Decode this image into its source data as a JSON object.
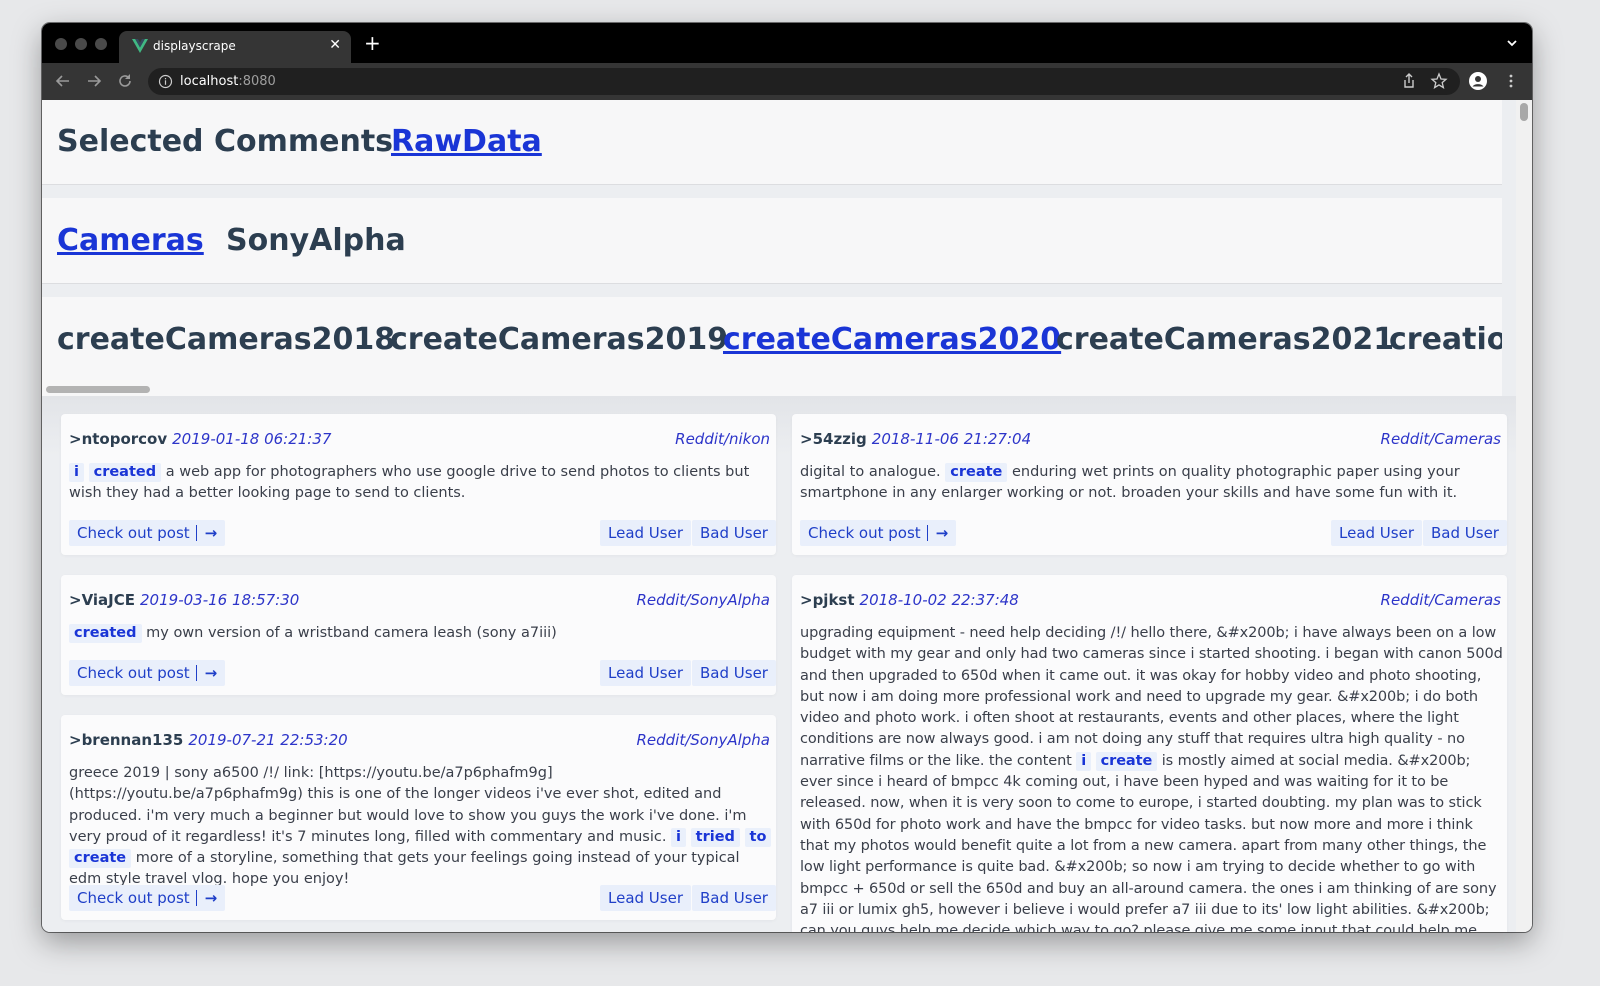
{
  "browser": {
    "tab_title": "displayscrape",
    "url_host": "localhost",
    "url_port": ":8080"
  },
  "nav": {
    "top": [
      {
        "label": "Selected Comments",
        "active": false
      },
      {
        "label": "RawData",
        "active": true
      }
    ],
    "sources": [
      {
        "label": "Cameras",
        "active": true
      },
      {
        "label": "SonyAlpha",
        "active": false
      }
    ],
    "datasets": [
      {
        "label": "createCameras2018",
        "active": false
      },
      {
        "label": "createCameras2019",
        "active": false
      },
      {
        "label": "createCameras2020",
        "active": true
      },
      {
        "label": "createCameras2021",
        "active": false
      },
      {
        "label": "creation",
        "active": false
      }
    ]
  },
  "buttons": {
    "check_out": "Check out post",
    "lead_user": "Lead User",
    "bad_user": "Bad User"
  },
  "comments": [
    {
      "user": ">ntoporcov",
      "date": "2019-01-18 06:21:37",
      "source": "Reddit/nikon",
      "segments": [
        {
          "t": "i",
          "hl": true
        },
        {
          "t": " "
        },
        {
          "t": "created",
          "hl": true
        },
        {
          "t": " a web app for photographers who use google drive to send photos to clients but wish they had a better looking page to send to clients."
        }
      ]
    },
    {
      "user": ">ViaJCE",
      "date": "2019-03-16 18:57:30",
      "source": "Reddit/SonyAlpha",
      "segments": [
        {
          "t": "created",
          "hl": true
        },
        {
          "t": " my own version of a wristband camera leash (sony a7iii)"
        }
      ]
    },
    {
      "user": ">brennan135",
      "date": "2019-07-21 22:53:20",
      "source": "Reddit/SonyAlpha",
      "segments": [
        {
          "t": "greece 2019 | sony a6500 /!/ link: [https://youtu.be/a7p6phafm9g](https://youtu.be/a7p6phafm9g) this is one of the longer videos i've ever shot, edited and produced. i'm very much a beginner but would love to show you guys the work i've done. i'm very proud of it regardless! it's 7 minutes long, filled with commentary and music. "
        },
        {
          "t": "i",
          "hl": true
        },
        {
          "t": " "
        },
        {
          "t": "tried",
          "hl": true
        },
        {
          "t": " "
        },
        {
          "t": "to",
          "hl": true
        },
        {
          "t": " "
        },
        {
          "t": "create",
          "hl": true
        },
        {
          "t": " more of a storyline, something that gets your feelings going instead of your typical edm style travel vlog. hope you enjoy!"
        }
      ]
    },
    {
      "user": ">54zzig",
      "date": "2018-11-06 21:27:04",
      "source": "Reddit/Cameras",
      "segments": [
        {
          "t": "digital to analogue. "
        },
        {
          "t": "create",
          "hl": true
        },
        {
          "t": " enduring wet prints on quality photographic paper using your smartphone in any enlarger working or not. broaden your skills and have some fun with it."
        }
      ]
    },
    {
      "user": ">pjkst",
      "date": "2018-10-02 22:37:48",
      "source": "Reddit/Cameras",
      "segments": [
        {
          "t": "upgrading equipment - need help deciding /!/ hello there, &#x200b; i have always been on a low budget with my gear and only had two cameras since i started shooting. i began with canon 500d and then upgraded to 650d when it came out. it was okay for hobby video and photo shooting, but now i am doing more professional work and need to upgrade my gear. &#x200b; i do both video and photo work. i often shoot at restaurants, events and other places, where the light conditions are now always good. i am not doing any stuff that requires ultra high quality - no narrative films or the like. the content "
        },
        {
          "t": "i",
          "hl": true
        },
        {
          "t": " "
        },
        {
          "t": "create",
          "hl": true
        },
        {
          "t": " is mostly aimed at social media. &#x200b; ever since i heard of bmpcc 4k coming out, i have been hyped and was waiting for it to be released. now, when it is very soon to come to europe, i started doubting. my plan was to stick with 650d for photo work and have the bmpcc for video tasks. but now more and more i think that my photos would benefit quite a lot from a new camera. apart from many other things, the low light performance is quite bad. &#x200b; so now i am trying to decide whether to go with bmpcc + 650d or sell the 650d and buy an all-around camera. the ones i am thinking of are sony a7 iii or lumix gh5, however i believe i would prefer a7 iii due to its' low light abilities. &#x200b; can you guys help me decide which way to go? please give me some input that could help me decide. thanks!"
        }
      ]
    }
  ]
}
